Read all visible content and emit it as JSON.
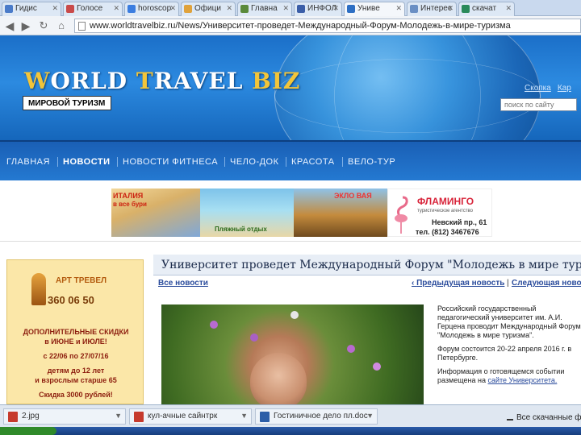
{
  "browser": {
    "tabs": [
      {
        "label": "Гидис",
        "color": "#4a7bc9"
      },
      {
        "label": "Голосе",
        "color": "#c94a4a"
      },
      {
        "label": "horoscop",
        "color": "#3b7de0"
      },
      {
        "label": "Офици",
        "color": "#e0a23b"
      },
      {
        "label": "Главна",
        "color": "#5a8a3b"
      },
      {
        "label": "ИНФОЛ",
        "color": "#3b5ea8"
      },
      {
        "label": "Униве",
        "color": "#2d6fc4"
      },
      {
        "label": "Интерес",
        "color": "#6a8fc4"
      },
      {
        "label": "скачат",
        "color": "#2a8a5a"
      }
    ],
    "active_tab": 6,
    "address": "www.worldtravelbiz.ru/News/Университет-проведет-Международный-Форум-Молодежь-в-мире-туризма"
  },
  "site": {
    "logo_part1": "W",
    "logo_part2": "ORLD ",
    "logo_part3": "T",
    "logo_part4": "RAVEL ",
    "logo_part5": "BIZ",
    "tagline": "МИРОВОЙ ТУРИЗМ",
    "header_link_1": "Скопка",
    "header_link_2": "Кар",
    "search_placeholder": "поиск по сайту"
  },
  "nav": {
    "items": [
      {
        "label": "ГЛАВНАЯ",
        "active": false
      },
      {
        "label": "НОВОСТИ",
        "active": true
      },
      {
        "label": "НОВОСТИ ФИТНЕСА",
        "active": false
      },
      {
        "label": "ЧЕЛО-ДОК",
        "active": false
      },
      {
        "label": "КРАСОТА",
        "active": false
      },
      {
        "label": "ВЕЛО-ТУР",
        "active": false
      }
    ]
  },
  "ads": {
    "italy_text": "ИТАЛИЯ",
    "italy_text2": "в все бури",
    "thai_text": "ЭКЛО ВАЯ",
    "beach_text": "Пляжный отдых",
    "flamingo_name": "ФЛАМИНГО",
    "flamingo_sub": "туристическое агентство",
    "flamingo_addr": "Невский пр., 61",
    "flamingo_tel": "тел. (812) 3467676"
  },
  "sidebar_ad": {
    "brand": "АРТ ТРЕВЕЛ",
    "phone": "360 06 50",
    "line1": "ДОПОЛНИТЕЛЬНЫЕ СКИДКИ",
    "line2": "в ИЮНЕ и ИЮЛЕ!",
    "line3": "с 22/06 по 27/07/16",
    "line4": "детям до 12 лет",
    "line5": "и взрослым старше 65",
    "line6": "Скидка 3000 рублей!"
  },
  "article": {
    "title": "Университет проведет Международный Форум \"Молодежь в мире туризм",
    "all_news": "Все новости",
    "prev": "Предыдущая новость",
    "next": "Следующая новос",
    "para1": "Российский государственный педагогический университет им. А.И. Герцена проводит Международный Форум \"Молодежь в мире туризма\".",
    "para2": "Форум состоится 20-22 апреля 2016 г. в Петербурге.",
    "para3a": "Информация о готовящемся событии размещена на ",
    "para3b": "сайте Университета."
  },
  "downloads": {
    "items": [
      {
        "name": "2.jpg",
        "type": "img"
      },
      {
        "name": "кул-ачные сайнтрк",
        "type": "pdf"
      },
      {
        "name": "Гостиничное дело пл.doc",
        "type": "doc"
      }
    ],
    "show_all": "Все скачанные файлы..."
  }
}
